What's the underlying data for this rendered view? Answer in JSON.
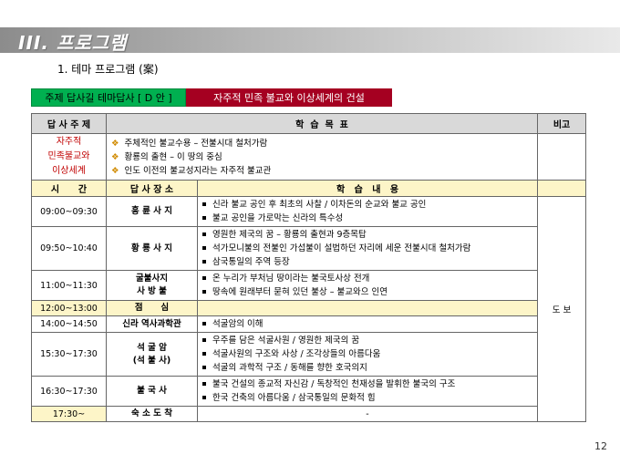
{
  "header": {
    "title": "III. 프로그램",
    "subtitle": "1. 테마 프로그램 (案)"
  },
  "theme_bar": {
    "label": "주제 답사길 테마답사 [ D 안 ]",
    "title": "자주적 민족 불교와 이상세계의 건설"
  },
  "table": {
    "headers": {
      "topic": "답 사 주 제",
      "goal": "학  습  목  표",
      "note": "비고",
      "time": "시      간",
      "place": "답 사 장 소",
      "content": "학   습   내   용"
    },
    "topic": [
      "자주적",
      "민족불교와",
      "이상세계"
    ],
    "goals": [
      "주체적인 불교수용 – 전불시대 철처가람",
      "황룡의 출현 – 이 땅의 중심",
      "인도 이전의 불교성지라는 자주적 불교관"
    ],
    "note": "도 보",
    "rows": [
      {
        "time": "09:00~09:30",
        "place": [
          "흥 륜 사 지"
        ],
        "content": [
          "신라 불교 공인 후 최초의 사찰 / 이차돈의 순교와 불교 공인",
          "불교 공인을 가로막는 신라의 특수성"
        ]
      },
      {
        "time": "09:50~10:40",
        "place": [
          "황 룡 사 지"
        ],
        "content": [
          "영원한 제국의 꿈 – 황룡의 출현과 9층목탑",
          "석가모니불의 전불인 가섭불이 설법하던 자리에 세운 전불시대 철처가람",
          "삼국통일의 주역 등장"
        ]
      },
      {
        "time": "11:00~11:30",
        "place": [
          "굴불사지",
          "사 방 불"
        ],
        "content": [
          "온 누리가 부처님 땅이라는 불국토사상 전개",
          "땅속에 원래부터 묻혀 있던 불상 – 불교와으 인연"
        ]
      },
      {
        "time": "12:00~13:00",
        "place": [
          "점      심"
        ],
        "content": []
      },
      {
        "time": "14:00~14:50",
        "place": [
          "신라 역사과학관"
        ],
        "content": [
          "석굴암의 이해"
        ]
      },
      {
        "time": "15:30~17:30",
        "place": [
          "석 굴 암",
          "(석 불 사)"
        ],
        "content": [
          "우주를 담은 석굴사원 / 영원한 제국의 꿈",
          "석굴사원의 구조와 사상 / 조각상들의 아름다움",
          "석굴의 과학적 구조 / 동해를 향한 호국의지"
        ]
      },
      {
        "time": "16:30~17:30",
        "place": [
          "불 국 사"
        ],
        "content": [
          "불국 건설의 종교적 자신감 / 독창적인 천재성을 발휘한 불국의 구조",
          "한국 건축의 아름다움 / 삼국통일의 문화적 힘"
        ]
      },
      {
        "time": "17:30~",
        "place": [
          "숙 소 도 착"
        ],
        "content_text": "-"
      }
    ]
  },
  "page_number": "12",
  "colors": {
    "accent_green": "#00b050",
    "accent_red": "#a50021",
    "topic_text": "#c00000",
    "header_gray": "#d9d9d9",
    "row_yellow": "#fdf5c8",
    "diamond_orange": "#d08a00"
  },
  "icons": {
    "goal_bullet": "diamond-bullet-icon",
    "content_bullet": "square-bullet-icon"
  }
}
